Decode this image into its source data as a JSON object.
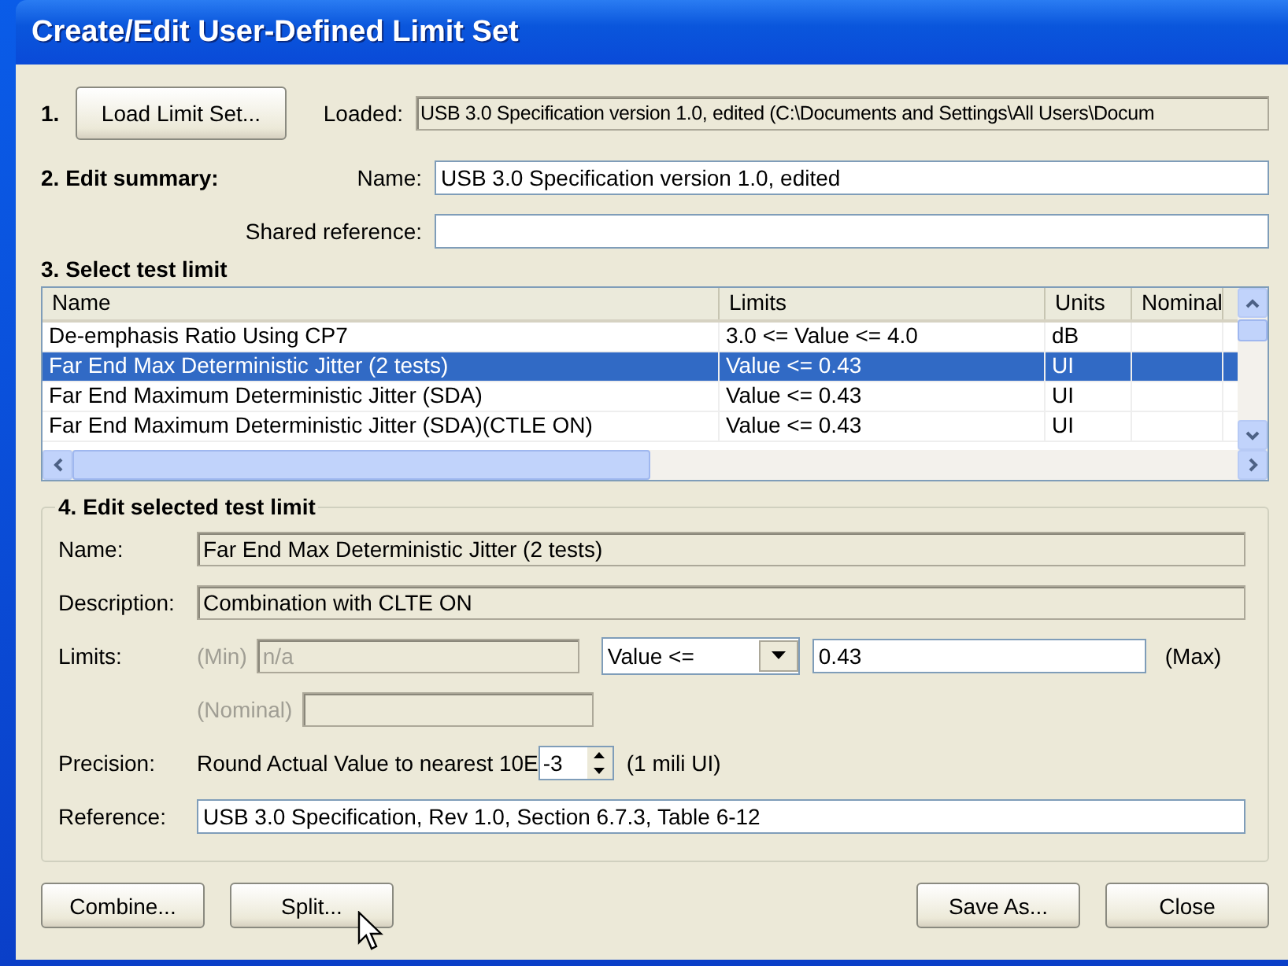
{
  "window": {
    "title": "Create/Edit User-Defined Limit Set"
  },
  "step1": {
    "number": "1.",
    "button": "Load Limit Set...",
    "loaded_label": "Loaded:",
    "loaded_value": "USB 3.0 Specification version 1.0, edited  (C:\\Documents and Settings\\All Users\\Docum"
  },
  "step2": {
    "heading": "2. Edit summary:",
    "name_label": "Name:",
    "name_value": "USB 3.0 Specification version 1.0, edited",
    "shared_label": "Shared reference:"
  },
  "step3": {
    "heading": "3. Select test limit",
    "table": {
      "columns": [
        "Name",
        "Limits",
        "Units",
        "Nominal"
      ],
      "rows": [
        {
          "cells": [
            "De-emphasis Ratio Using CP7",
            "3.0 <= Value <= 4.0",
            "dB",
            ""
          ],
          "selected": false
        },
        {
          "cells": [
            "Far End Max Deterministic Jitter (2 tests)",
            "Value <= 0.43",
            "UI",
            ""
          ],
          "selected": true
        },
        {
          "cells": [
            "Far End Maximum Deterministic Jitter (SDA)",
            "Value <= 0.43",
            "UI",
            ""
          ],
          "selected": false
        },
        {
          "cells": [
            "Far End Maximum Deterministic Jitter (SDA)(CTLE ON)",
            "Value <= 0.43",
            "UI",
            ""
          ],
          "selected": false
        }
      ]
    }
  },
  "step4": {
    "heading": "4. Edit selected test limit",
    "name_label": "Name:",
    "name_value": "Far End Max Deterministic Jitter (2 tests)",
    "description_label": "Description:",
    "description_value": "Combination with CLTE ON",
    "limits_label": "Limits:",
    "min_label": "(Min)",
    "min_value": "n/a",
    "min_disabled": true,
    "operator": "Value <=",
    "max_value": "0.43",
    "max_label": "(Max)",
    "nominal_label": "(Nominal)",
    "nominal_disabled": true,
    "precision_label": "Precision:",
    "precision_text": "Round Actual Value to nearest 10E",
    "precision_value": "-3",
    "precision_note": "(1 mili UI)",
    "reference_label": "Reference:",
    "reference_value": "USB 3.0 Specification, Rev 1.0, Section 6.7.3, Table 6-12"
  },
  "buttons_left": [
    "Combine...",
    "Split..."
  ],
  "buttons_right": [
    "Save As...",
    "Close"
  ]
}
